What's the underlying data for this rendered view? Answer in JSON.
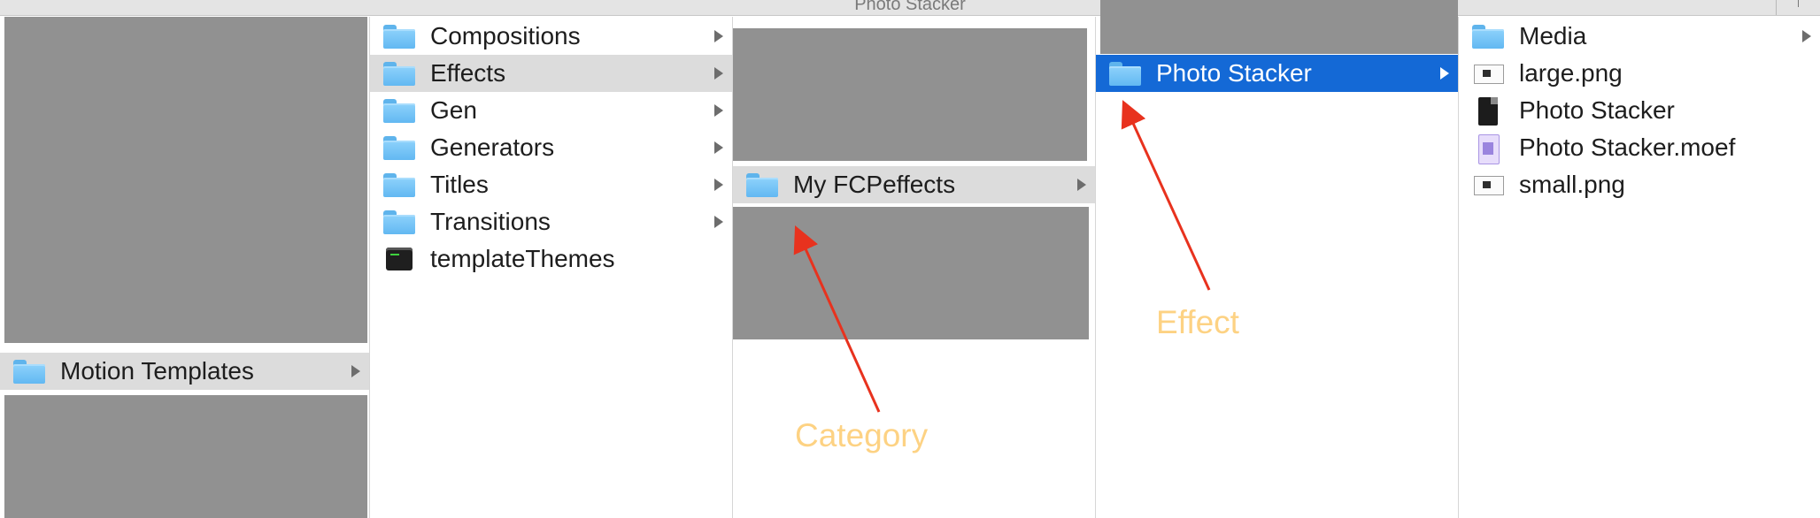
{
  "window": {
    "title": "Photo Stacker"
  },
  "columns": {
    "c1": {
      "items": [
        {
          "label": "Motion Templates",
          "icon": "folder-icon"
        }
      ]
    },
    "c2": {
      "items": [
        {
          "label": "Compositions",
          "icon": "folder-icon"
        },
        {
          "label": "Effects",
          "icon": "folder-icon"
        },
        {
          "label": "Gen",
          "icon": "folder-icon"
        },
        {
          "label": "Generators",
          "icon": "folder-icon"
        },
        {
          "label": "Titles",
          "icon": "folder-icon"
        },
        {
          "label": "Transitions",
          "icon": "folder-icon"
        },
        {
          "label": "templateThemes",
          "icon": "terminal-icon"
        }
      ]
    },
    "c3": {
      "items": [
        {
          "label": "My FCPeffects",
          "icon": "folder-icon"
        }
      ]
    },
    "c4": {
      "items": [
        {
          "label": "Photo Stacker",
          "icon": "folder-icon"
        }
      ]
    },
    "c5": {
      "items": [
        {
          "label": "Media",
          "icon": "folder-icon"
        },
        {
          "label": "large.png",
          "icon": "image-file-icon"
        },
        {
          "label": "Photo Stacker",
          "icon": "document-icon"
        },
        {
          "label": "Photo Stacker.moef",
          "icon": "motion-file-icon"
        },
        {
          "label": "small.png",
          "icon": "image-file-icon"
        }
      ]
    }
  },
  "annotations": {
    "category": "Category",
    "effect": "Effect"
  },
  "colors": {
    "selection": "#1469d6",
    "highlight": "#dcdcdc",
    "arrow": "#e8321e",
    "annotation_text": "#fdd283",
    "redaction": "#919191"
  }
}
